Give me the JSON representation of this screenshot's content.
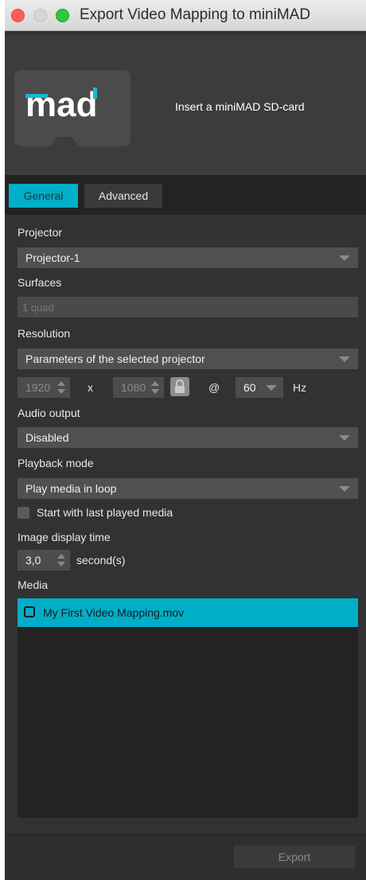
{
  "window": {
    "title": "Export Video Mapping to miniMAD"
  },
  "header": {
    "logo_text": "mad",
    "message": "Insert a miniMAD SD-card"
  },
  "tabs": [
    {
      "label": "General",
      "active": true
    },
    {
      "label": "Advanced",
      "active": false
    }
  ],
  "form": {
    "projector": {
      "label": "Projector",
      "value": "Projector-1"
    },
    "surfaces": {
      "label": "Surfaces",
      "value": "1 quad"
    },
    "resolution": {
      "label": "Resolution",
      "value": "Parameters of the selected projector",
      "width": "1920",
      "times": "x",
      "height": "1080",
      "at": "@",
      "rate": "60",
      "unit": "Hz"
    },
    "audio": {
      "label": "Audio output",
      "value": "Disabled"
    },
    "playback": {
      "label": "Playback mode",
      "value": "Play media in loop"
    },
    "start_last": {
      "label": "Start with last played media",
      "checked": false
    },
    "image_time": {
      "label": "Image display time",
      "value": "3,0",
      "unit": "second(s)"
    },
    "media": {
      "label": "Media",
      "items": [
        {
          "name": "My First Video Mapping.mov",
          "checked": false,
          "selected": true
        }
      ]
    }
  },
  "footer": {
    "export_label": "Export"
  },
  "colors": {
    "accent": "#00aec7",
    "background": "#323232"
  }
}
